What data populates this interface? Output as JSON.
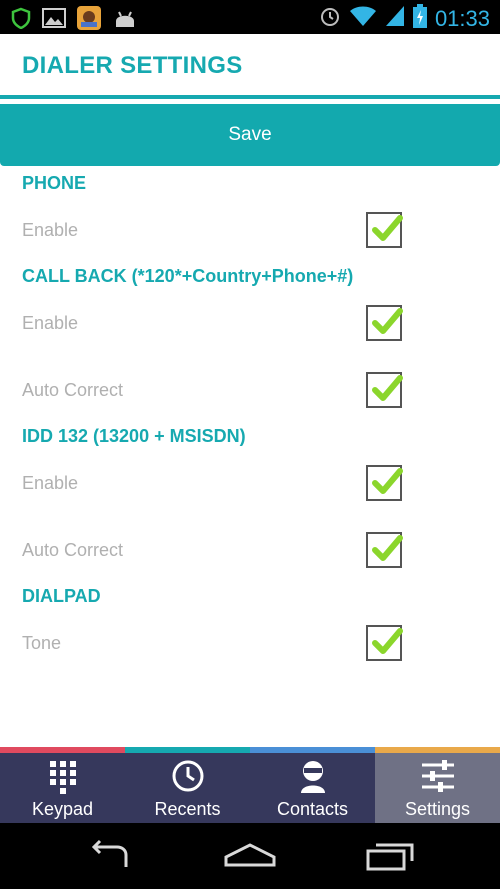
{
  "status_bar": {
    "time": "01:33"
  },
  "header": {
    "title": "DIALER SETTINGS"
  },
  "save_button": {
    "label": "Save"
  },
  "sections": [
    {
      "title": "PHONE",
      "rows": [
        {
          "label": "Enable",
          "checked": true
        }
      ]
    },
    {
      "title": "CALL BACK (*120*+Country+Phone+#)",
      "rows": [
        {
          "label": "Enable",
          "checked": true
        },
        {
          "label": "Auto Correct",
          "checked": true
        }
      ]
    },
    {
      "title": "IDD 132 (13200 + MSISDN)",
      "rows": [
        {
          "label": "Enable",
          "checked": true
        },
        {
          "label": "Auto Correct",
          "checked": true
        }
      ]
    },
    {
      "title": "DIALPAD",
      "rows": [
        {
          "label": "Tone",
          "checked": true
        }
      ]
    }
  ],
  "bottom_nav": [
    {
      "label": "Keypad",
      "icon": "keypad-icon"
    },
    {
      "label": "Recents",
      "icon": "clock-icon"
    },
    {
      "label": "Contacts",
      "icon": "contact-icon"
    },
    {
      "label": "Settings",
      "icon": "sliders-icon",
      "active": true
    }
  ],
  "colors": {
    "accent": "#16a9b0",
    "nav_bg": "#36385c",
    "nav_active": "#6f7185",
    "label_gray": "#b0b0b0"
  }
}
